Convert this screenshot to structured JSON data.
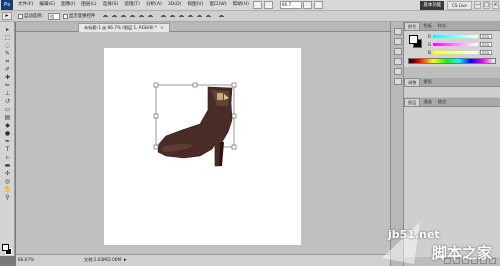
{
  "app": {
    "logo": "Ps",
    "menus": [
      "文件(F)",
      "编辑(E)",
      "图像(I)",
      "图层(L)",
      "选择(S)",
      "滤镜(T)",
      "分析(A)",
      "3D(D)",
      "视图(V)",
      "窗口(W)",
      "帮助(H)"
    ],
    "zoom": "66.7",
    "workspace_label": "基本功能",
    "cs_live_label": "CS Live",
    "window_controls": [
      "—",
      "□",
      "×"
    ]
  },
  "options_bar": {
    "auto_select_label": "自动选择：",
    "auto_select_value": "组",
    "show_transform_label": "显示变换控件"
  },
  "document": {
    "tab_title": "未标题-1 @ 66.7% (图层 1, RGB/8) *",
    "tab_close": "×"
  },
  "status": {
    "zoom": "66.67%",
    "doc_size": "文档:1.03M/2.00M",
    "arrow": "▸"
  },
  "color_panel": {
    "tabs": [
      "颜色",
      "色板",
      "样式"
    ],
    "channels": [
      {
        "label": "R",
        "value": "255"
      },
      {
        "label": "G",
        "value": "255"
      },
      {
        "label": "B",
        "value": "255"
      }
    ],
    "foreground": "#ffffff",
    "background": "#000000"
  },
  "adjust_panel": {
    "tabs": [
      "调整",
      "蒙版"
    ]
  },
  "layers_panel": {
    "tabs": [
      "图层",
      "通道",
      "路径"
    ]
  },
  "watermark": {
    "site": "jb51.net",
    "name": "脚本之家"
  },
  "colors": {
    "boot": "#4a2c26",
    "boot_highlight": "#6b4a40",
    "buckle": "#c9b07a",
    "canvas": "#ffffff",
    "workspace": "#c0c0c0"
  }
}
